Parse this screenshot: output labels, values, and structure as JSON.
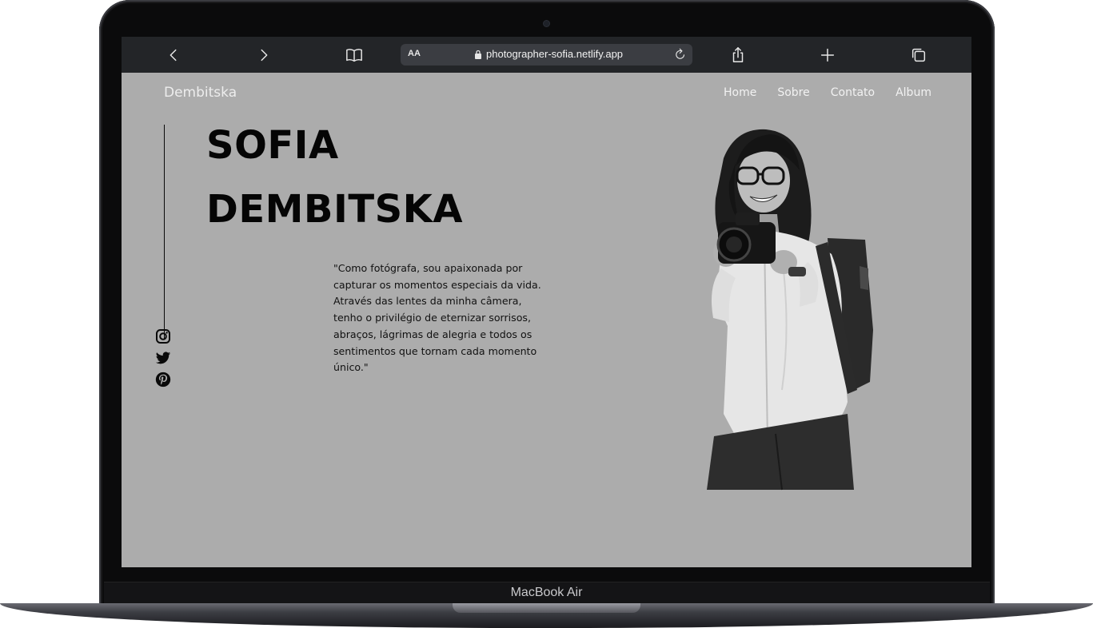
{
  "device": {
    "model_label": "MacBook Air"
  },
  "browser": {
    "text_size_label": "AA",
    "url": "photographer-sofia.netlify.app",
    "icons": [
      "chevron-left-icon",
      "chevron-right-icon",
      "book-icon",
      "lock-icon",
      "reload-icon",
      "share-icon",
      "plus-icon",
      "tabs-icon"
    ]
  },
  "site": {
    "brand": "Dembitska",
    "nav": [
      "Home",
      "Sobre",
      "Contato",
      "Album"
    ],
    "hero": {
      "title_line1": "SOFIA",
      "title_line2": "DEMBITSKA",
      "quote": "\"Como fotógrafa, sou apaixonada por capturar os momentos especiais da vida. Através das lentes da minha câmera, tenho o privilégio de eternizar sorrisos, abraços, lágrimas de alegria e todos os sentimentos que tornam cada momento único.\""
    },
    "social": [
      "instagram-icon",
      "twitter-icon",
      "pinterest-icon"
    ],
    "colors": {
      "page_background": "#acacac",
      "text_dark": "#050505",
      "nav_text": "#f2f2f2",
      "browser_bar": "#232528"
    }
  }
}
